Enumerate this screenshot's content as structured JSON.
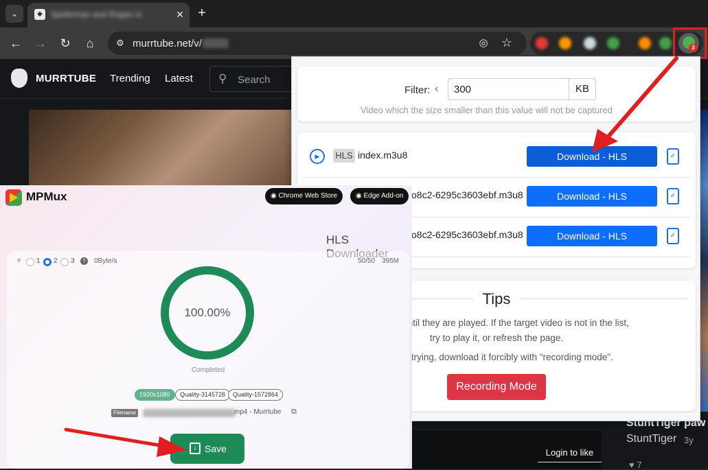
{
  "browser": {
    "tab_title": "Spiderman and Rogan in ",
    "url": "murrtube.net/v/",
    "ext_badge": "3"
  },
  "site": {
    "name": "MURRTUBE",
    "nav": [
      "Trending",
      "Latest"
    ],
    "search_placeholder": "Search",
    "video_title_fragment": "StuntTiger paw",
    "uploader": "StuntTiger",
    "uploader_age": "3y",
    "likes": "7",
    "login_to_like": "Login to like"
  },
  "popup": {
    "filter_label": "Filter:",
    "filter_value": "300",
    "filter_unit": "KB",
    "filter_hint": "Video which the size smaller than this value will not be captured",
    "rows": [
      {
        "type": "HLS",
        "name": "index.m3u8",
        "button": "Download - HLS"
      },
      {
        "type": "",
        "name": "o8c2-6295c3603ebf.m3u8",
        "button": "Download - HLS"
      },
      {
        "type": "",
        "name": "o8c2-6295c3603ebf.m3u8",
        "button": "Download - HLS"
      }
    ],
    "tips_title": "Tips",
    "tips_line_1": "captured until they are played. If the target video is not in the list,",
    "tips_line_2": "try to play it, or refresh the page.",
    "tips_line_3": "rk after trying, download it forcibly with \"recording mode\".",
    "recording_button": "Recording Mode",
    "colors": {
      "primary": "#0d6efd",
      "danger": "#dc3545"
    }
  },
  "mpmux": {
    "app_name": "MPMux",
    "chrome_store": "Chrome Web Store",
    "edge_addon": "Edge Add-on",
    "heading": "HLS Downloader",
    "threads": [
      "1",
      "2",
      "3"
    ],
    "selected_thread": "2",
    "speed": "0Byte/s",
    "segments": "50/50",
    "total_size": "395M",
    "progress_text": "100.00%",
    "progress": 1.0,
    "status": "Completed",
    "chips": [
      "1920x1080",
      "Quality-3145728",
      "Quality-1572864"
    ],
    "filename_label": "Filename",
    "filename_suffix": "mp4 - Murrtube",
    "save_label": "Save",
    "colors": {
      "accent": "#1e8a57"
    }
  }
}
